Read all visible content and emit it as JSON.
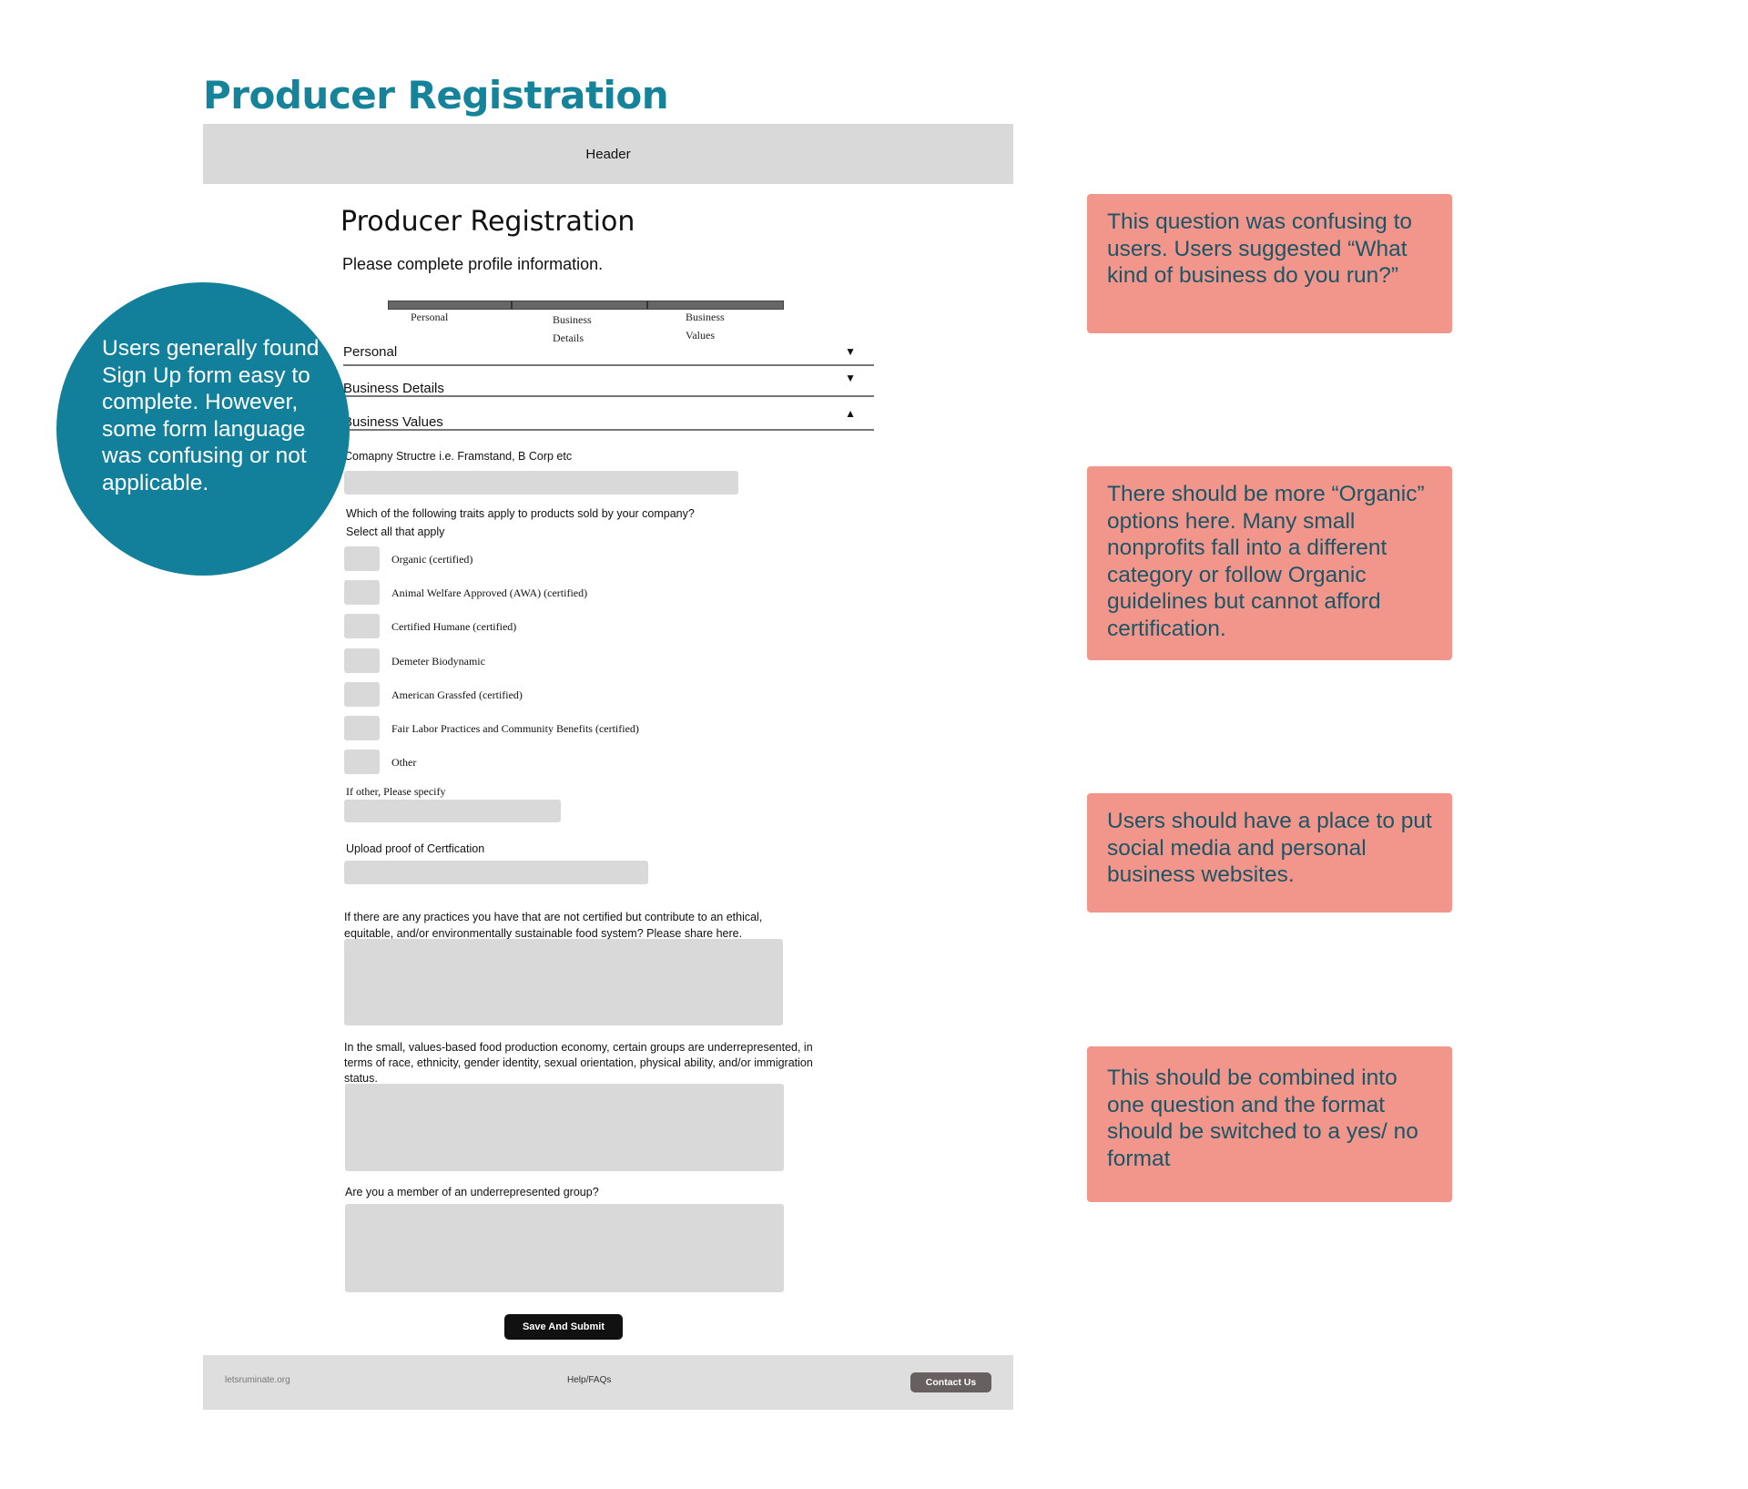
{
  "page_title": "Producer Registration",
  "header": {
    "label": "Header"
  },
  "form": {
    "title": "Producer Registration",
    "subtitle": "Please complete profile information.",
    "steps": [
      {
        "line1": "Personal",
        "line2": ""
      },
      {
        "line1": "Business",
        "line2": "Details"
      },
      {
        "line1": "Business",
        "line2": "Values"
      }
    ],
    "sections": [
      {
        "label": "Personal",
        "state": "collapsed"
      },
      {
        "label": "Business Details",
        "state": "collapsed"
      },
      {
        "label": "Business Values",
        "state": "expanded"
      }
    ],
    "company_structure_label": "Comapny Structre i.e. Framstand, B Corp etc",
    "traits_question": "Which of the following traits apply to products sold by your company?",
    "traits_hint": "Select all that apply",
    "traits": [
      "Organic (certified)",
      "Animal Welfare Approved (AWA) (certified)",
      "Certified Humane (certified)",
      "Demeter Biodynamic",
      "American Grassfed (certified)",
      "Fair Labor Practices and Community Benefits (certified)",
      "Other"
    ],
    "other_label": "If other, Please specify",
    "upload_label": "Upload proof of Certfication",
    "practices_label": "If there are any practices you have that are not certified but contribute to an ethical, equitable, and/or environmentally sustainable food system? Please share here.",
    "underrep_label": "In the small, values-based food production economy, certain groups are underrepresented, in terms of race, ethnicity, gender identity, sexual orientation, physical ability, and/or immigration status.",
    "member_label": "Are you a member of an underrepresented group?",
    "submit": "Save And Submit"
  },
  "footer": {
    "site": "letsruminate.org",
    "help": "Help/FAQs",
    "contact": "Contact Us"
  },
  "annotations": {
    "circle": "Users generally found Sign Up form easy to complete. However, some form language was confusing or not applicable.",
    "notes": [
      "This question was confusing to users. Users suggested “What kind of business do you run?”",
      "There should be more “Organic” options here. Many small nonprofits fall into a different category or follow Organic guidelines but cannot afford certification.",
      "Users should have a place to put social media and personal business websites.",
      "This should be combined into one question and the format should be switched to a yes/ no format"
    ]
  },
  "colors": {
    "accent": "#15839a",
    "note": "#f2958b",
    "note_text": "#1b5666"
  }
}
